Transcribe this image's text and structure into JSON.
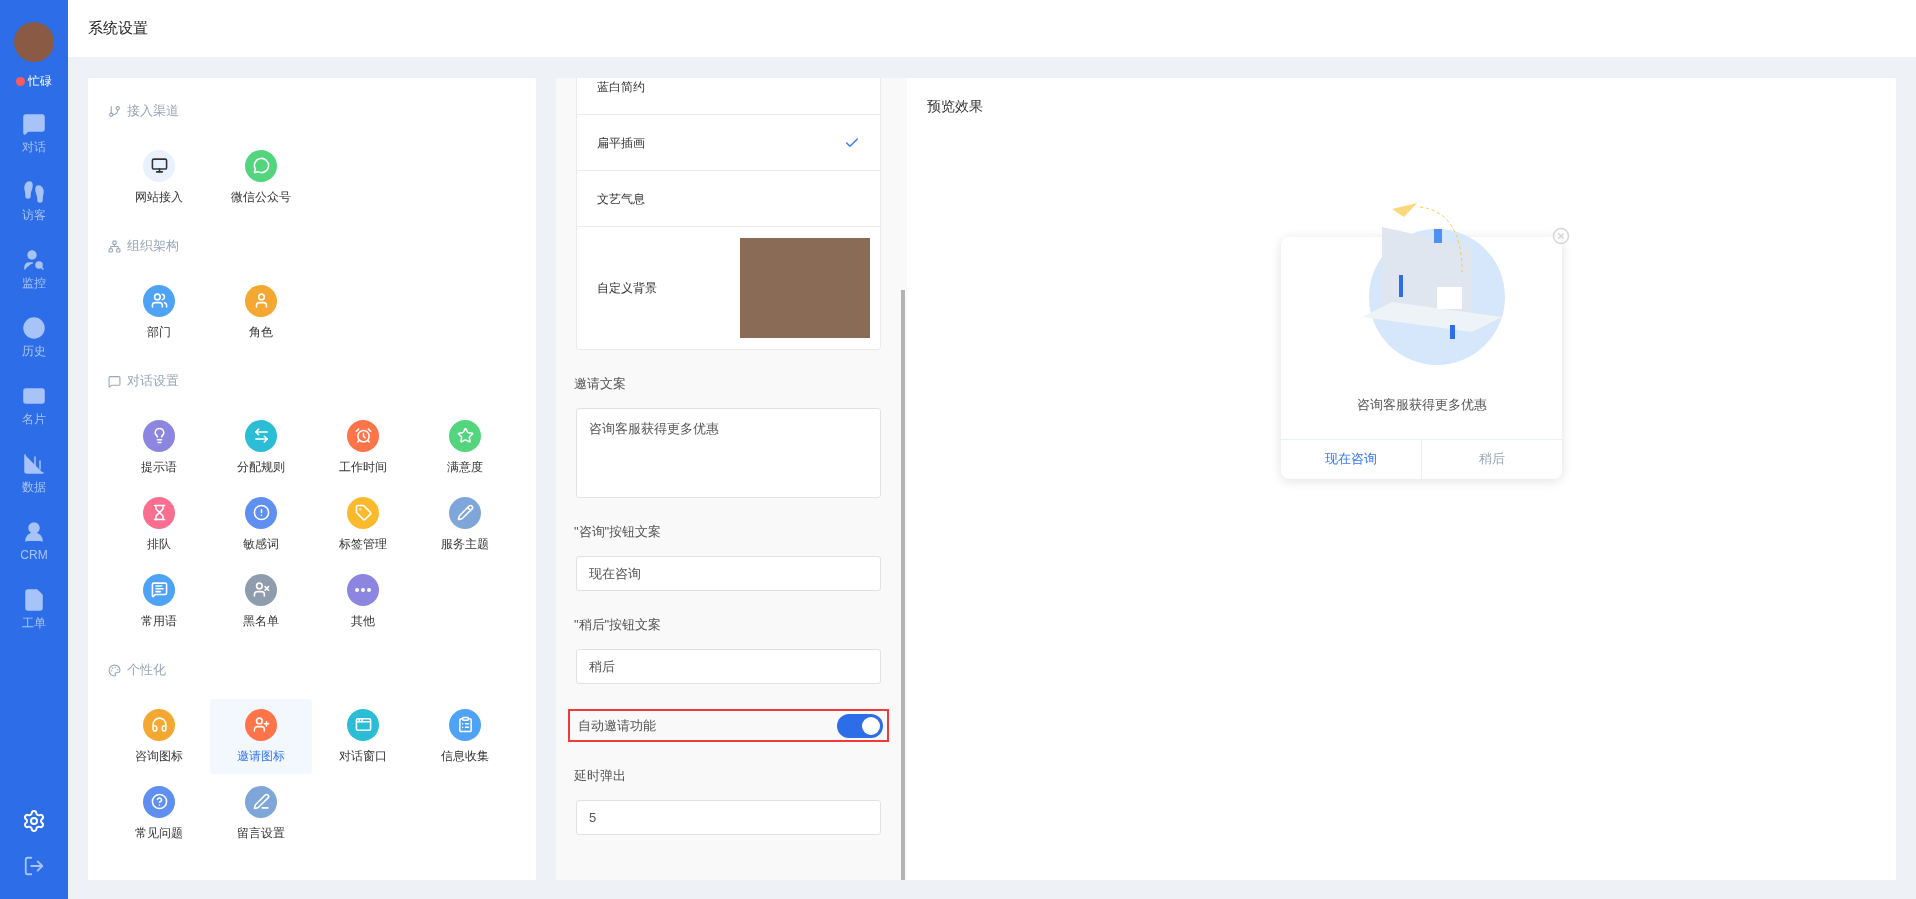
{
  "sidebar": {
    "status": {
      "label": "忙碌",
      "color": "#ff5a5a"
    },
    "nav": [
      {
        "label": "对话"
      },
      {
        "label": "访客"
      },
      {
        "label": "监控"
      },
      {
        "label": "历史"
      },
      {
        "label": "名片"
      },
      {
        "label": "数据"
      },
      {
        "label": "CRM"
      },
      {
        "label": "工单"
      }
    ]
  },
  "header": {
    "title": "系统设置"
  },
  "settings": {
    "sections": [
      {
        "title": "接入渠道",
        "items": [
          {
            "label": "网站接入",
            "color": "#e8f1fd",
            "selected": false
          },
          {
            "label": "微信公众号",
            "color": "#52d57c",
            "selected": false
          }
        ]
      },
      {
        "title": "组织架构",
        "items": [
          {
            "label": "部门",
            "color": "#4fa3f7",
            "selected": false
          },
          {
            "label": "角色",
            "color": "#f5a831",
            "selected": false
          }
        ]
      },
      {
        "title": "对话设置",
        "items": [
          {
            "label": "提示语",
            "color": "#8c86e0",
            "selected": false
          },
          {
            "label": "分配规则",
            "color": "#2bbcd6",
            "selected": false
          },
          {
            "label": "工作时间",
            "color": "#ff7448",
            "selected": false
          },
          {
            "label": "满意度",
            "color": "#52d57c",
            "selected": false
          },
          {
            "label": "排队",
            "color": "#fa6f8f",
            "selected": false
          },
          {
            "label": "敏感词",
            "color": "#5f8ff0",
            "selected": false
          },
          {
            "label": "标签管理",
            "color": "#fdb92c",
            "selected": false
          },
          {
            "label": "服务主题",
            "color": "#7fa6d9",
            "selected": false
          },
          {
            "label": "常用语",
            "color": "#4fa3f7",
            "selected": false
          },
          {
            "label": "黑名单",
            "color": "#8f9cad",
            "selected": false
          },
          {
            "label": "其他",
            "color": "#8c86e0",
            "selected": false
          }
        ]
      },
      {
        "title": "个性化",
        "items": [
          {
            "label": "咨询图标",
            "color": "#f5a831",
            "selected": false
          },
          {
            "label": "邀请图标",
            "color": "#ff7448",
            "selected": true
          },
          {
            "label": "对话窗口",
            "color": "#2bbcd6",
            "selected": false
          },
          {
            "label": "信息收集",
            "color": "#4fa3f7",
            "selected": false
          },
          {
            "label": "常见问题",
            "color": "#5f8ff0",
            "selected": false
          },
          {
            "label": "留言设置",
            "color": "#7fa6d9",
            "selected": false
          }
        ]
      }
    ]
  },
  "form": {
    "themes": [
      {
        "label": "蓝白简约",
        "selected": false
      },
      {
        "label": "扁平插画",
        "selected": true
      },
      {
        "label": "文艺气息",
        "selected": false
      },
      {
        "label": "自定义背景",
        "selected": false,
        "kind": "image"
      }
    ],
    "invite_text": {
      "label": "邀请文案",
      "value": "咨询客服获得更多优惠"
    },
    "consult_button": {
      "label": "\"咨询\"按钮文案",
      "value": "现在咨询"
    },
    "later_button": {
      "label": "\"稍后\"按钮文案",
      "value": "稍后"
    },
    "auto_invite": {
      "label": "自动邀请功能",
      "on": true,
      "highlighted": true
    },
    "delay": {
      "label": "延时弹出",
      "value": "5"
    }
  },
  "preview": {
    "title": "预览效果",
    "message": "咨询客服获得更多优惠",
    "buttons": [
      {
        "label": "现在咨询",
        "kind": "primary"
      },
      {
        "label": "稍后",
        "kind": "secondary"
      }
    ]
  }
}
